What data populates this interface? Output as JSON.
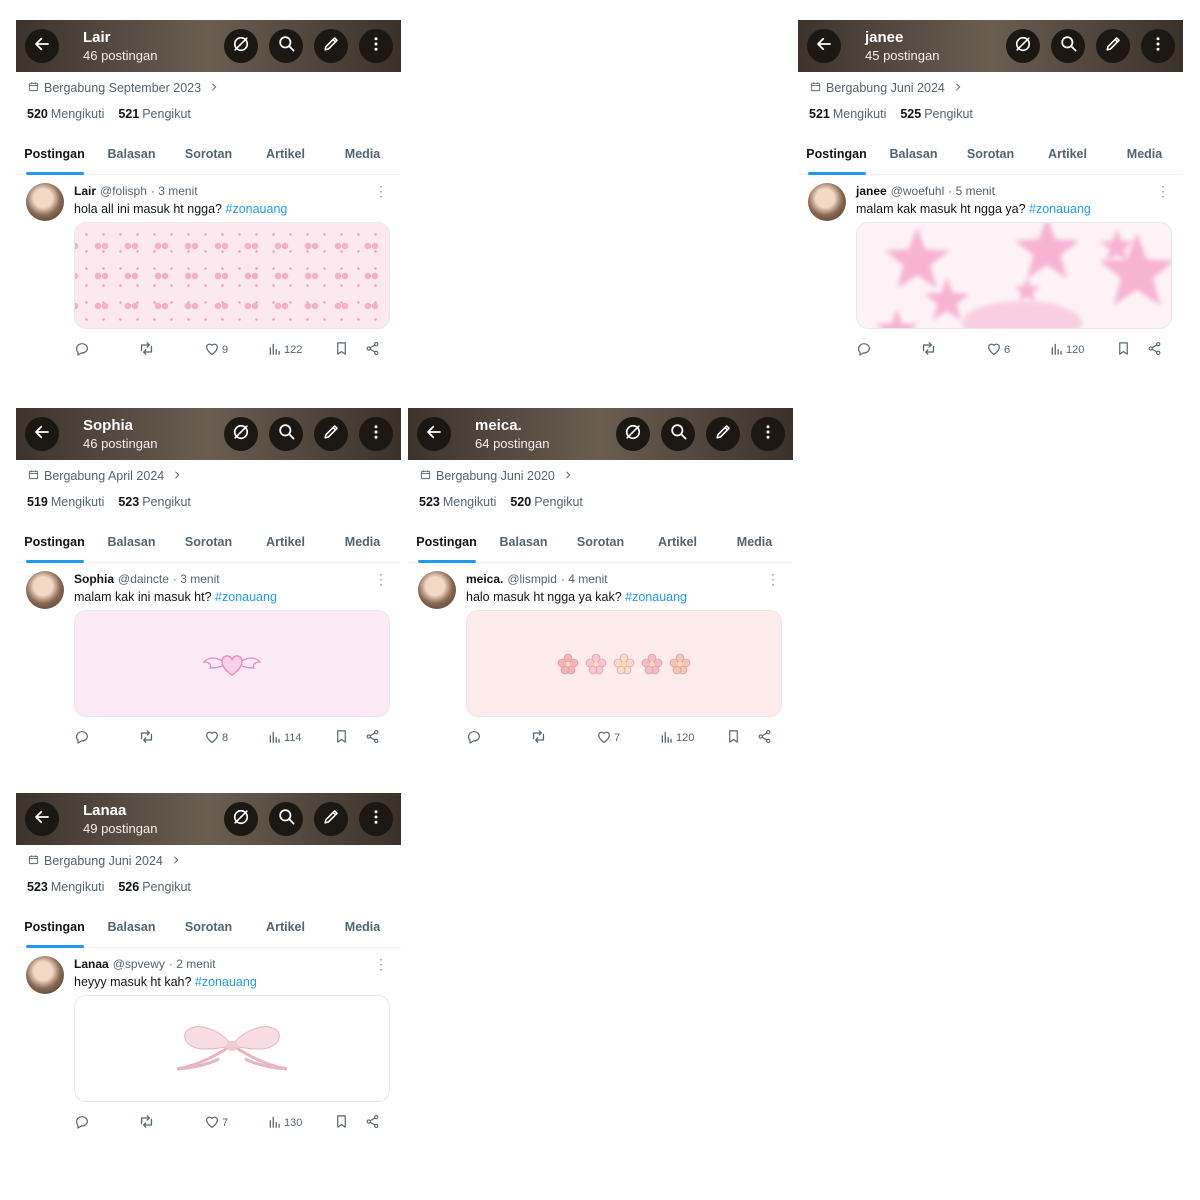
{
  "ui": {
    "tabs": [
      "Postingan",
      "Balasan",
      "Sorotan",
      "Artikel",
      "Media"
    ],
    "following_label": "Mengikuti",
    "followers_label": "Pengikut"
  },
  "colors": {
    "accent": "#1d9bf0",
    "header_bg": "#4e443a",
    "hashtag": "#1d9bf0"
  },
  "profiles": [
    {
      "name": "Lair",
      "posts_count": "46 postingan",
      "joined": "Bergabung September 2023",
      "following": "520",
      "followers": "521",
      "post": {
        "display_name": "Lair",
        "handle": "@folisph",
        "time": "· 3 menit",
        "text": "hola all ini masuk ht ngga?",
        "hashtag": "#zonauang",
        "likes": "9",
        "views": "122",
        "media_icon": "pink-bows-pattern"
      }
    },
    {
      "name": "janee",
      "posts_count": "45 postingan",
      "joined": "Bergabung Juni 2024",
      "following": "521",
      "followers": "525",
      "post": {
        "display_name": "janee",
        "handle": "@woefuhl",
        "time": "· 5 menit",
        "text": "malam kak masuk ht ngga ya?",
        "hashtag": "#zonauang",
        "likes": "6",
        "views": "120",
        "media_icon": "pink-stars"
      }
    },
    {
      "name": "Sophia",
      "posts_count": "46 postingan",
      "joined": "Bergabung April 2024",
      "following": "519",
      "followers": "523",
      "post": {
        "display_name": "Sophia",
        "handle": "@daincte",
        "time": "· 3 menit",
        "text": "malam kak ini masuk ht?",
        "hashtag": "#zonauang",
        "likes": "8",
        "views": "114",
        "media_icon": "winged-heart"
      }
    },
    {
      "name": "meica.",
      "posts_count": "64 postingan",
      "joined": "Bergabung Juni 2020",
      "following": "523",
      "followers": "520",
      "post": {
        "display_name": "meica.",
        "handle": "@lismpid",
        "time": "· 4 menit",
        "text": "halo masuk ht ngga ya kak?",
        "hashtag": "#zonauang",
        "likes": "7",
        "views": "120",
        "media_icon": "flower-row"
      }
    },
    {
      "name": "Lanaa",
      "posts_count": "49 postingan",
      "joined": "Bergabung Juni 2024",
      "following": "523",
      "followers": "526",
      "post": {
        "display_name": "Lanaa",
        "handle": "@spvewy",
        "time": "· 2 menit",
        "text": "heyyy masuk ht kah?",
        "hashtag": "#zonauang",
        "likes": "7",
        "views": "130",
        "media_icon": "pink-ribbon-bow"
      }
    }
  ]
}
